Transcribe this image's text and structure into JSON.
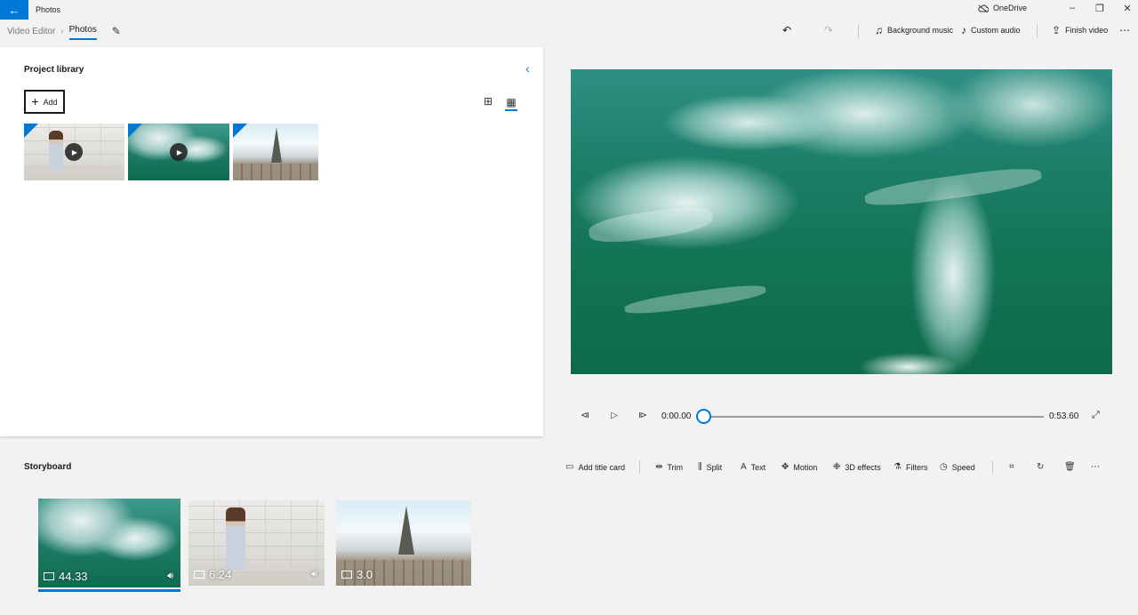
{
  "titlebar": {
    "app_title": "Photos",
    "onedrive_label": "OneDrive"
  },
  "toolbar": {
    "breadcrumb_root": "Video Editor",
    "breadcrumb_current": "Photos",
    "background_music_label": "Background music",
    "custom_audio_label": "Custom audio",
    "finish_video_label": "Finish video"
  },
  "library": {
    "title": "Project library",
    "add_label": "Add",
    "items": [
      {
        "kind": "video",
        "subject": "woman"
      },
      {
        "kind": "video",
        "subject": "sea"
      },
      {
        "kind": "photo",
        "subject": "paris"
      }
    ]
  },
  "playback": {
    "current_time": "0:00.00",
    "total_time": "0:53.60",
    "progress": 0
  },
  "storyboard": {
    "title": "Storyboard",
    "tools": {
      "add_title_card": "Add title card",
      "trim": "Trim",
      "split": "Split",
      "text": "Text",
      "motion": "Motion",
      "effects_3d": "3D effects",
      "filters": "Filters",
      "speed": "Speed"
    },
    "clips": [
      {
        "duration": "44.33",
        "kind": "video",
        "selected": true
      },
      {
        "duration": "6.24",
        "kind": "video",
        "selected": false
      },
      {
        "duration": "3.0",
        "kind": "photo",
        "selected": false
      }
    ]
  },
  "colors": {
    "accent": "#0078d7",
    "panel": "#ffffff",
    "background": "#f2f2f2"
  }
}
